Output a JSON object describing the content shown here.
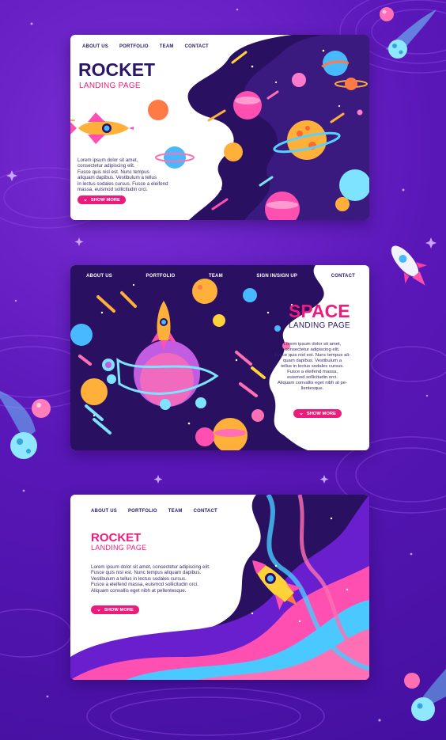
{
  "colors": {
    "background": "#5a17b8",
    "accent_pink": "#ec1c7d",
    "title_navy": "#2b1766",
    "space_dark": "#2a1060"
  },
  "cards": [
    {
      "nav": [
        "ABOUT US",
        "PORTFOLIO",
        "TEAM",
        "CONTACT"
      ],
      "title": "ROCKET",
      "subtitle": "LANDING PAGE",
      "body": [
        "Lorem ipsum dolor sit amet,",
        "consectetur adipiscing elit.",
        "Fusce quis nisl est. Nunc tempus",
        "aliquam dapibus. Vestibulum a tellus",
        "in lectus sodales cursus. Fusce a eleifend",
        "massa, euismod sollicitudin orci."
      ],
      "button": "SHOW MORE",
      "icons": [
        "rocket-icon",
        "planet-icon",
        "comet-icon",
        "star-icon"
      ]
    },
    {
      "nav": [
        "ABOUT US",
        "PORTFOLIO",
        "TEAM",
        "SIGN IN/SIGN UP",
        "CONTACT"
      ],
      "title": "SPACE",
      "subtitle": "LANDING PAGE",
      "body": [
        "Lorem ipsum dolor sit amet,",
        "consectetur adipiscing elit.",
        "Fusce quis nisl est. Nunc tempus ali-",
        "quam dapibus. Vestibulum a",
        "tellus in lectus sodales cursus.",
        "Fusce a eleifend massa,",
        "euismod sollicitudin orci.",
        "Aliquam convallis eget nibh at pe-",
        "llentesque."
      ],
      "button": "SHOW MORE",
      "icons": [
        "rocket-icon",
        "planet-icon",
        "comet-icon",
        "star-icon"
      ]
    },
    {
      "nav": [
        "ABOUT US",
        "PORTFOLIO",
        "TEAM",
        "CONTACT"
      ],
      "title": "ROCKET",
      "subtitle": "LANDING PAGE",
      "body": [
        "Lorem ipsum dolor sit amet, consectetur adipiscing elit.",
        "Fusce quis nisl est. Nunc tempus aliquam dapibus.",
        "Vestibulum a tellus in lectus sodales cursus.",
        "Fusce a eleifend massa, euismod sollicitudin orci.",
        "Aliquam convallis eget nibh at pellentesque."
      ],
      "button": "SHOW MORE",
      "icons": [
        "rocket-icon",
        "wave-icon"
      ]
    }
  ]
}
